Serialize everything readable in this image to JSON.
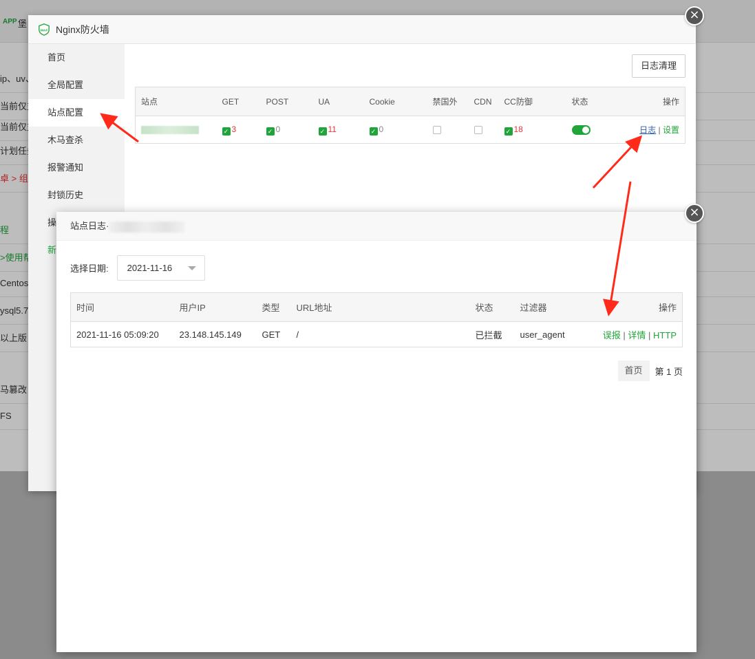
{
  "background": {
    "app_icon": "APP",
    "app_title": "堡",
    "rows": [
      "ip、uv、",
      "当前仅支",
      "当前仅支",
      "计划任务",
      "卓 > 组",
      "",
      "程",
      ">使用帮",
      "Centos",
      "ysql5.7",
      "以上版",
      "",
      "马篡改",
      "FS"
    ],
    "row_red": "> 组"
  },
  "waf": {
    "title": "Nginx防火墙",
    "logo_text": "WAF",
    "sidebar": [
      "首页",
      "全局配置",
      "站点配置",
      "木马查杀",
      "报警通知",
      "封锁历史",
      "操",
      "新"
    ],
    "clear_button": "日志清理",
    "table": {
      "headers": [
        "站点",
        "GET",
        "POST",
        "UA",
        "Cookie",
        "禁国外",
        "CDN",
        "CC防御",
        "状态",
        "操作"
      ],
      "row": {
        "get": "3",
        "post": "0",
        "ua": "11",
        "cookie": "0",
        "cc": "18",
        "log_link": "日志",
        "sep": "|",
        "settings_link": "设置"
      }
    },
    "close_icon": "×"
  },
  "log_dialog": {
    "title": "站点日志·",
    "close_icon": "×",
    "date_label": "选择日期:",
    "date_value": "2021-11-16",
    "table": {
      "headers": [
        "时间",
        "用户IP",
        "类型",
        "URL地址",
        "状态",
        "过滤器",
        "操作"
      ],
      "rows": [
        {
          "time": "2021-11-16 05:09:20",
          "ip": "23.148.145.149",
          "type": "GET",
          "url": "/",
          "status": "已拦截",
          "filter": "user_agent",
          "action_false_report": "误报",
          "action_detail": "详情",
          "action_http": "HTTP",
          "sep": "|"
        }
      ]
    },
    "pager": {
      "home": "首页",
      "page": "第 1 页"
    }
  },
  "colors": {
    "accent_green": "#20a53a",
    "arrow_red": "#ff2a1a",
    "count_red": "#ee3333"
  }
}
